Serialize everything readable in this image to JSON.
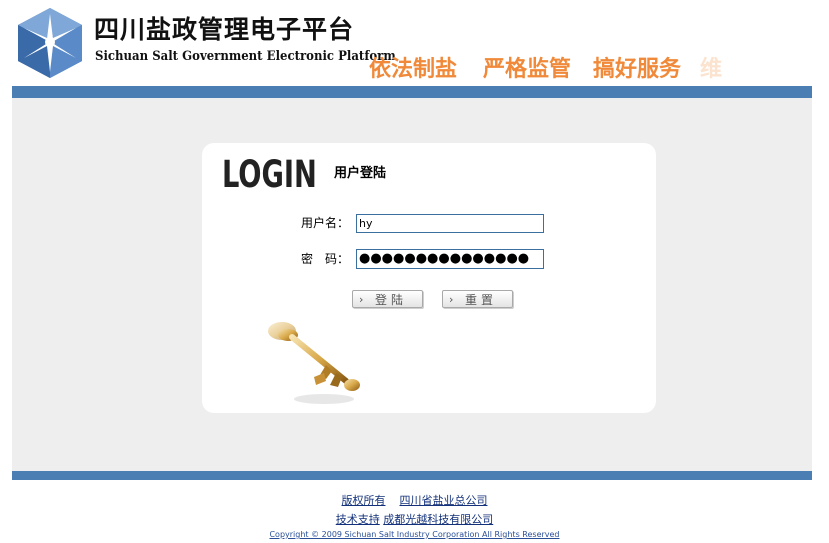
{
  "header": {
    "title_cn": "四川盐政管理电子平台",
    "title_en": "Sichuan Salt Government Electronic Platform",
    "slogans": [
      "依法制盐",
      "严格监管",
      "搞好服务",
      "维"
    ],
    "accent_color": "#f08a3a",
    "bar_color": "#4b7eb2",
    "logo_icon": "star-cube-logo-icon"
  },
  "login": {
    "heading": "LOGIN",
    "subheading": "用户登陆",
    "username_label": "用户名：",
    "username_value": "hy",
    "password_label": "密　码：",
    "password_masked": "●●●●●●●●●●●●●●●",
    "login_button": "登陆",
    "reset_button": "重置",
    "button_icon": "chevron-right-icon",
    "decor_icon": "golden-key-icon"
  },
  "footer": {
    "copyright_owner_label": "版权所有",
    "copyright_owner": "四川省盐业总公司",
    "support_label": "技术支持",
    "support_company": "成都光越科技有限公司",
    "copyright_en": "Copyright © 2009 Sichuan Salt Industry Corporation All Rights Reserved"
  }
}
